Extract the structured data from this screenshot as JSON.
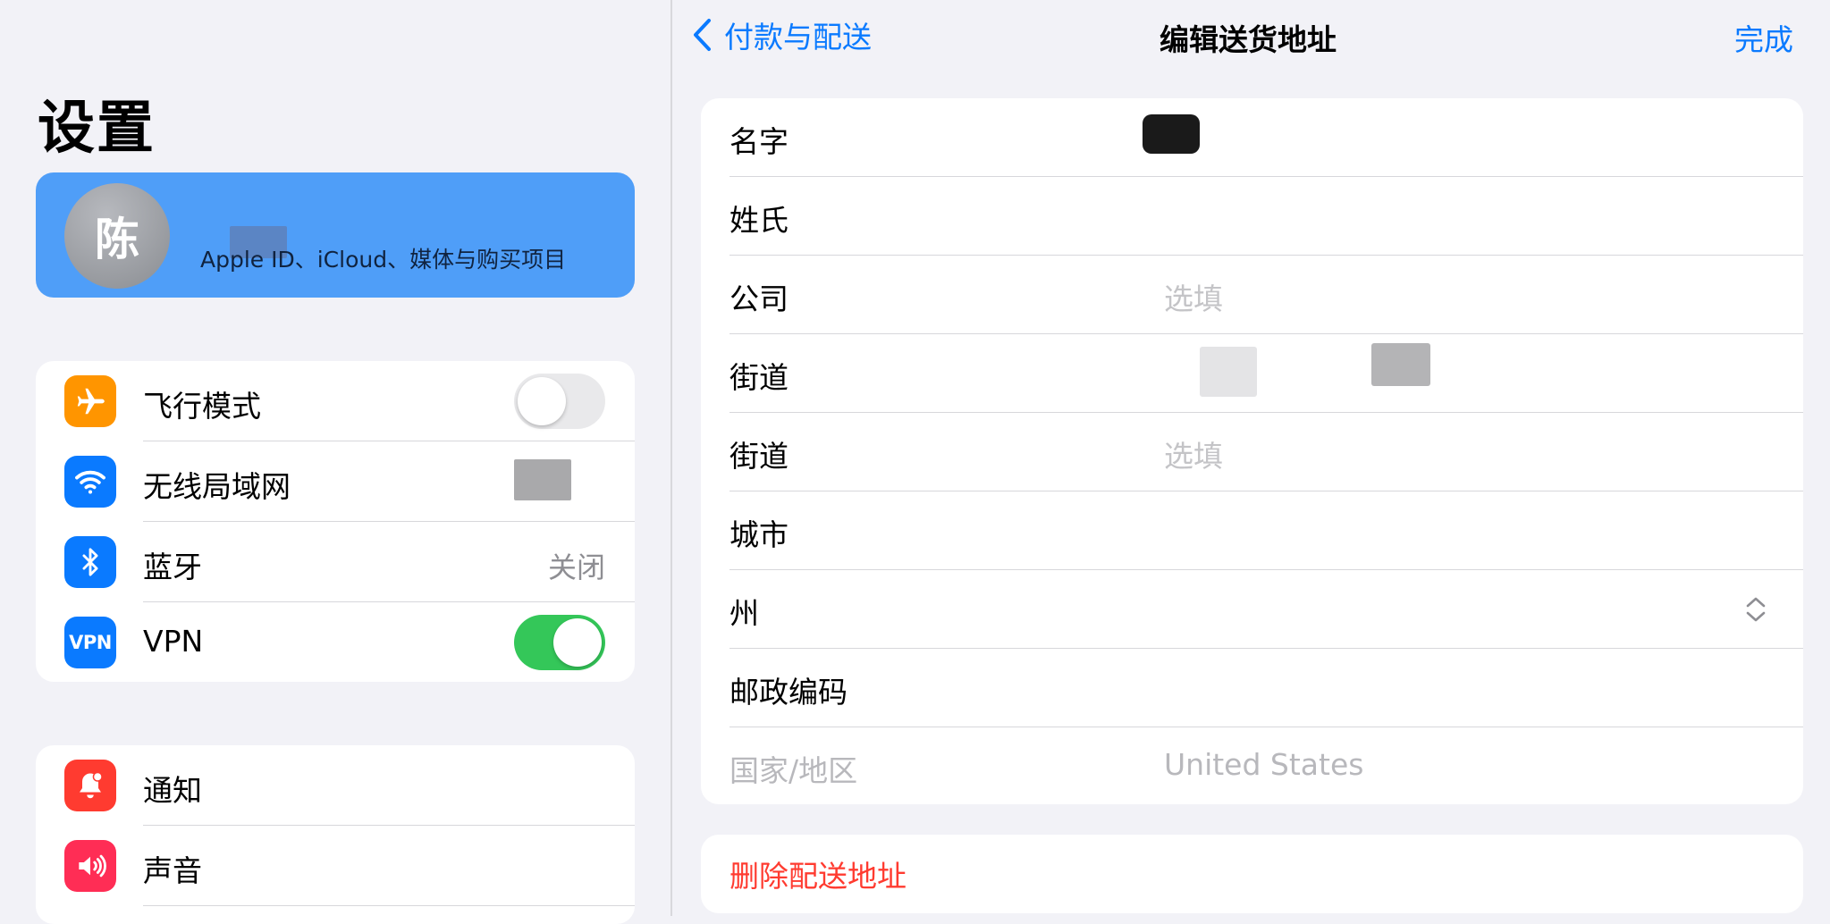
{
  "sidebar": {
    "title": "设置",
    "profile": {
      "avatar_initial": "陈",
      "subtitle": "Apple ID、iCloud、媒体与购买项目"
    },
    "group1": [
      {
        "label": "飞行模式",
        "icon": "airplane-icon",
        "icon_color": "#ff9500",
        "accessory": "toggle",
        "toggle_on": false
      },
      {
        "label": "无线局域网",
        "icon": "wifi-icon",
        "icon_color": "#0a7aff",
        "accessory": "value",
        "value": ""
      },
      {
        "label": "蓝牙",
        "icon": "bluetooth-icon",
        "icon_color": "#0a7aff",
        "accessory": "value",
        "value": "关闭"
      },
      {
        "label": "VPN",
        "icon": "vpn-icon",
        "icon_text": "VPN",
        "icon_color": "#0a7aff",
        "accessory": "toggle",
        "toggle_on": true
      }
    ],
    "group2": [
      {
        "label": "通知",
        "icon": "notification-bell-icon",
        "icon_color": "#ff3b30"
      },
      {
        "label": "声音",
        "icon": "speaker-icon",
        "icon_color": "#ff2d55"
      }
    ]
  },
  "nav": {
    "back_label": "付款与配送",
    "title": "编辑送货地址",
    "done_label": "完成"
  },
  "form": {
    "rows": [
      {
        "label": "名字",
        "value": "",
        "placeholder": ""
      },
      {
        "label": "姓氏",
        "value": "",
        "placeholder": ""
      },
      {
        "label": "公司",
        "value": "",
        "placeholder": "选填"
      },
      {
        "label": "街道",
        "value": "",
        "placeholder": ""
      },
      {
        "label": "街道",
        "value": "",
        "placeholder": "选填"
      },
      {
        "label": "城市",
        "value": "",
        "placeholder": ""
      },
      {
        "label": "州",
        "value": "",
        "placeholder": ""
      },
      {
        "label": "邮政编码",
        "value": "",
        "placeholder": ""
      },
      {
        "label": "国家/地区",
        "value": "United States",
        "placeholder": ""
      }
    ]
  },
  "delete_label": "删除配送地址",
  "colors": {
    "accent": "#0a7aff",
    "destructive": "#ff3b30",
    "toggle_on": "#34c759",
    "profile_card": "#4f9ef8",
    "background": "#f2f2f7"
  }
}
